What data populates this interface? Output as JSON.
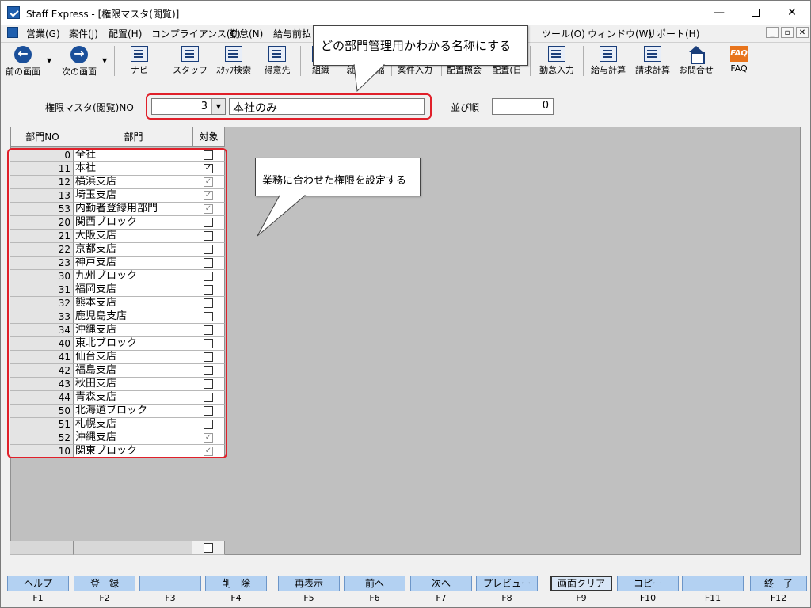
{
  "window": {
    "title": "Staff Express - [権限マスタ(閲覧)]",
    "min_glyph": "—",
    "close_glyph": "✕"
  },
  "menu": {
    "items": [
      "営業(G)",
      "案件(J)",
      "配置(H)",
      "コンプライアンス(C)",
      "勤怠(N)",
      "給与前払",
      "ツール(O)",
      "ウィンドウ(W)",
      "サポート(H)"
    ],
    "mdi_buttons": [
      "_",
      "▫",
      "✕"
    ]
  },
  "toolbar": {
    "items": [
      {
        "label": "前の画面",
        "icon": "back-icon"
      },
      {
        "label": "次の画面",
        "icon": "forward-icon"
      },
      {
        "label": "ナビ",
        "icon": "navi-icon"
      },
      {
        "label": "スタッフ",
        "icon": "staff-icon"
      },
      {
        "label": "ｽﾀｯﾌ検索",
        "icon": "staff-search-icon"
      },
      {
        "label": "得意先",
        "icon": "customer-icon"
      },
      {
        "label": "組織",
        "icon": "organization-icon"
      },
      {
        "label": "就",
        "icon": "work-icon"
      },
      {
        "label": "縮",
        "icon": "shrink-icon"
      },
      {
        "label": "案件入力",
        "icon": "case-entry-icon"
      },
      {
        "label": "配置照会",
        "icon": "placement-inquiry-icon"
      },
      {
        "label": "配置(日",
        "icon": "placement-daily-icon"
      },
      {
        "label": "勤怠入力",
        "icon": "attendance-entry-icon"
      },
      {
        "label": "給与計算",
        "icon": "payroll-icon"
      },
      {
        "label": "請求計算",
        "icon": "billing-icon"
      },
      {
        "label": "お問合せ",
        "icon": "inquiry-icon"
      },
      {
        "label": "FAQ",
        "icon": "faq-icon"
      }
    ],
    "faq_glyph": "FAQ",
    "back_glyph": "←",
    "forward_glyph": "→",
    "dropdown_glyph": "▼"
  },
  "form": {
    "master_label": "権限マスタ(閲覧)NO",
    "master_no": "3",
    "master_name": "本社のみ",
    "order_label": "並び順",
    "order_value": "0",
    "combo_glyph": "▼"
  },
  "grid": {
    "headers": {
      "no": "部門NO",
      "name": "部門",
      "target": "対象"
    },
    "rows": [
      {
        "no": "0",
        "name": "全社",
        "state": "unchecked"
      },
      {
        "no": "11",
        "name": "本社",
        "state": "checked"
      },
      {
        "no": "12",
        "name": "横浜支店",
        "state": "grey"
      },
      {
        "no": "13",
        "name": "埼玉支店",
        "state": "grey"
      },
      {
        "no": "53",
        "name": "内勤者登録用部門",
        "state": "grey"
      },
      {
        "no": "20",
        "name": "関西ブロック",
        "state": "unchecked"
      },
      {
        "no": "21",
        "name": "大阪支店",
        "state": "unchecked"
      },
      {
        "no": "22",
        "name": "京都支店",
        "state": "unchecked"
      },
      {
        "no": "23",
        "name": "神戸支店",
        "state": "unchecked"
      },
      {
        "no": "30",
        "name": "九州ブロック",
        "state": "unchecked"
      },
      {
        "no": "31",
        "name": "福岡支店",
        "state": "unchecked"
      },
      {
        "no": "32",
        "name": "熊本支店",
        "state": "unchecked"
      },
      {
        "no": "33",
        "name": "鹿児島支店",
        "state": "unchecked"
      },
      {
        "no": "34",
        "name": "沖縄支店",
        "state": "unchecked"
      },
      {
        "no": "40",
        "name": "東北ブロック",
        "state": "unchecked"
      },
      {
        "no": "41",
        "name": "仙台支店",
        "state": "unchecked"
      },
      {
        "no": "42",
        "name": "福島支店",
        "state": "unchecked"
      },
      {
        "no": "43",
        "name": "秋田支店",
        "state": "unchecked"
      },
      {
        "no": "44",
        "name": "青森支店",
        "state": "unchecked"
      },
      {
        "no": "50",
        "name": "北海道ブロック",
        "state": "unchecked"
      },
      {
        "no": "51",
        "name": "札幌支店",
        "state": "unchecked"
      },
      {
        "no": "52",
        "name": "沖縄支店",
        "state": "grey"
      },
      {
        "no": "10",
        "name": "関東ブロック",
        "state": "grey"
      }
    ],
    "check_glyph": "✓"
  },
  "callouts": {
    "top": "どの部門管理用かわかる名称にする",
    "grid": "業務に合わせた権限を設定する"
  },
  "fkeys": [
    {
      "key": "F1",
      "label": "ヘルプ"
    },
    {
      "key": "F2",
      "label": "登　録"
    },
    {
      "key": "F3",
      "label": ""
    },
    {
      "key": "F4",
      "label": "削　除"
    },
    {
      "key": "F5",
      "label": "再表示"
    },
    {
      "key": "F6",
      "label": "前へ"
    },
    {
      "key": "F7",
      "label": "次へ"
    },
    {
      "key": "F8",
      "label": "プレビュー"
    },
    {
      "key": "F9",
      "label": "画面クリア"
    },
    {
      "key": "F10",
      "label": "コピー"
    },
    {
      "key": "F11",
      "label": ""
    },
    {
      "key": "F12",
      "label": "終　了"
    }
  ],
  "colors": {
    "highlight_red": "#e0202a",
    "fkey_blue": "#b3d1f2",
    "grid_bg": "#c0c0c0"
  }
}
